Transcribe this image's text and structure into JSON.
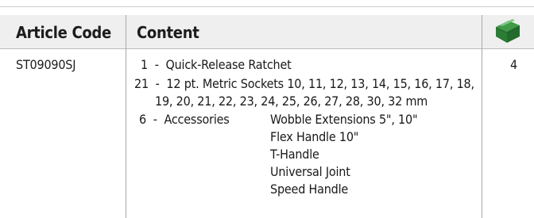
{
  "table": {
    "headers": {
      "article_code": "Article Code",
      "content": "Content",
      "qty_icon": "box-icon"
    },
    "row": {
      "article_code": "ST09090SJ",
      "quantity": "4",
      "items": [
        {
          "count": "1",
          "text": "Quick-Release Ratchet"
        },
        {
          "count": "21",
          "text": "12 pt. Metric Sockets 10, 11, 12, 13, 14, 15, 16, 17, 18,",
          "cont": "19, 20, 21, 22, 23, 24, 25, 26, 27, 28, 30, 32 mm"
        },
        {
          "count": "6",
          "text": "Accessories"
        }
      ],
      "accessories": [
        "Wobble Extensions 5\", 10\"",
        "Flex Handle 10\"",
        "T-Handle",
        "Universal Joint",
        "Speed Handle"
      ]
    },
    "accent_color": "#2e8b3a"
  }
}
